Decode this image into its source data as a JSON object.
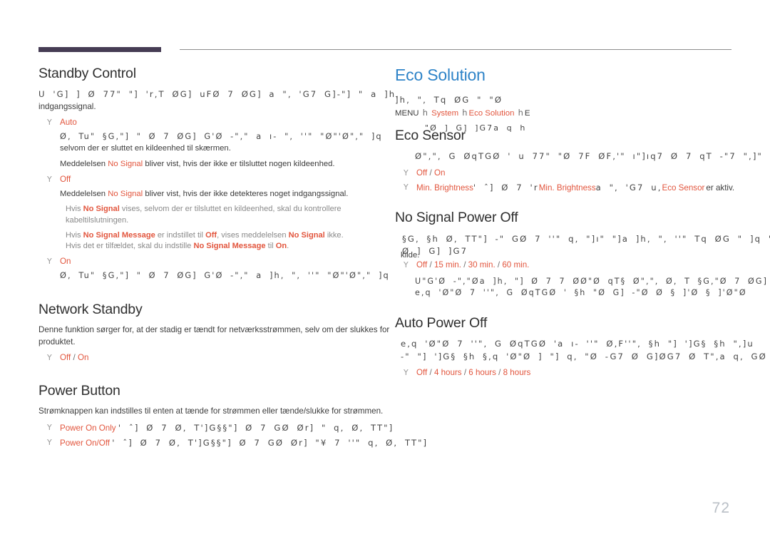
{
  "page": {
    "number": "72",
    "accent_color": "#2f84c8",
    "option_color": "#e2553d",
    "rule_color": "#463c54"
  },
  "left_column": {
    "standby_control": {
      "title": "Standby Control",
      "intro_garbled": "U  'G]  ]  Ø 77\"  \"]  'r,T ØG] uFØ 7 ØG] a   \",  'G7 G]-\"] \" a ]h,",
      "intro_tail": "indgangssignal.",
      "options": [
        {
          "marker": "Y",
          "label": "Auto",
          "desc_garbled": "Ø, Tu\" §G,\"] \" Ø 7 ØG]  G'Ø -\",\" a ı-      \",  ''\"  \"Ø\"'Ø\",\"  ]q",
          "desc_tail": "selvom der er sluttet en kildeenhed til skærmen.",
          "desc_line2_pre": "Meddelelsen ",
          "desc_line2_hi": "No Signal",
          "desc_line2_post": " bliver vist, hvis der ikke er tilsluttet nogen kildeenhed."
        },
        {
          "marker": "Y",
          "label": "Off",
          "desc_line1_pre": "Meddelelsen ",
          "desc_line1_hi": "No Signal",
          "desc_line1_post": " bliver vist, hvis der ikke detekteres noget indgangssignal."
        },
        {
          "marker": "Y",
          "label": "On",
          "desc_garbled": "Ø, Tu\" §G,\"] \" Ø 7 ØG]  G'Ø -\",\" a ]h,  \",  ''\"  \"Ø\"'Ø\",\"  ]q"
        }
      ],
      "notes": [
        {
          "pre": "Hvis ",
          "hi1": "No Signal",
          "mid": " vises, selvom der er tilsluttet en kildeenhed, skal du kontrollere kabeltilslutningen."
        },
        {
          "pre": "Hvis ",
          "hi1": "No Signal Message",
          "mid": " er indstillet til ",
          "hi2": "Off",
          "mid2": ", vises meddelelsen ",
          "hi3": "No Signal",
          "post": " ikke."
        },
        {
          "pre": "Hvis det er tilfældet, skal du indstille ",
          "hi1": "No Signal Message",
          "mid": " til ",
          "hi2": "On",
          "post": "."
        }
      ]
    },
    "network_standby": {
      "title": "Network Standby",
      "body": "Denne funktion sørger for, at der stadig er tændt for netværksstrømmen, selv om der slukkes for produktet.",
      "option_marker": "Y",
      "option_a": "Off",
      "option_sep": " / ",
      "option_b": "On"
    },
    "power_button": {
      "title": "Power Button",
      "body": "Strømknappen kan indstilles til enten at tænde for strømmen eller tænde/slukke for strømmen.",
      "options": [
        {
          "marker": "Y",
          "label": "Power On Only",
          "garbled": "' ˆ]   Ø 7   Ø, T']G§§\"] Ø 7 GØ Ør] \"  q,  Ø, TT\"]"
        },
        {
          "marker": "Y",
          "label": "Power On/Off",
          "garbled": "' ˆ]   Ø 7   Ø, T']G§§\"] Ø 7 GØ Ør] \"¥ 7 ''\"  q,  Ø, TT\"]"
        }
      ]
    }
  },
  "right_column": {
    "eco_solution": {
      "title": "Eco Solution",
      "intro_garbled": "]h,  \", Tq ØG \"  \"Ø",
      "breadcrumb": {
        "root": "MENU",
        "arrow": "h",
        "item1": "System",
        "item2": "Eco Solution",
        "tail": "E"
      }
    },
    "eco_sensor": {
      "title": "Eco Sensor",
      "overlay_garbled": "\"Ø  ]  G]      ]G7a  q   h",
      "body_garbled": "Ø\",\", G ØqTGØ  ' u 77\" \"Ø  7F  ØF,'\"   ı\"]ıq7  Ø 7 qT  -\"7 \",]\"",
      "option_marker": "Y",
      "option_a": "Off",
      "option_sep": " / ",
      "option_b": "On",
      "min_brightness": {
        "marker": "Y",
        "label": "Min. Brightness",
        "garbled": "' ˆ]   Ø 7   'r",
        "overlap_label": "Min. Brightness",
        "mid_garbled": "a   \",  'G7 u,",
        "overlap_label2": "Eco Sensor",
        "tail": "er aktiv."
      }
    },
    "no_signal_power_off": {
      "title": "No Signal Power Off",
      "body_garbled_1": "§G, §h  Ø, TT\"] -\"  GØ  7 ''\"  q, \"]ı\" \"]a ]h,  \",  ''\" Tq ØG \"  ]q \"Ø",
      "body_garbled_2": "Ø  ]  G]      ]G7",
      "body_tail": "kilde.",
      "option_marker": "Y",
      "options": [
        "Off",
        "15 min.",
        "30 min.",
        "60 min."
      ],
      "note_garbled_1": "U\"G'Ø -\",\"Øa ]h, \"] Ø 7 7 ØØ\"Ø  qT§ Ø\",\",    Ø, T §G,\"Ø 7 ØG]",
      "note_garbled_2": "e,q  'Ø\"Ø 7 ''\", G ØqTGØ  ' §h \"Ø G]  -\"Ø Ø   § ]'Ø      § ]'Ø\"Ø"
    },
    "auto_power_off": {
      "title": "Auto Power Off",
      "body_garbled_1": "e,q  'Ø\"Ø 7 ''\", G ØqTGØ  'a ı-        ''\" Ø,F''\", §h \"] ']G§ §h   \",]u",
      "body_garbled_2": "-\"  \"] ']G§ §h §,q  'Ø\"Ø  ] \"]  q, \"Ø   -G7 Ø G]ØG7 Ø T\",a  q, GØ",
      "option_marker": "Y",
      "options": [
        "Off",
        "4 hours",
        "6 hours",
        "8 hours"
      ]
    }
  }
}
